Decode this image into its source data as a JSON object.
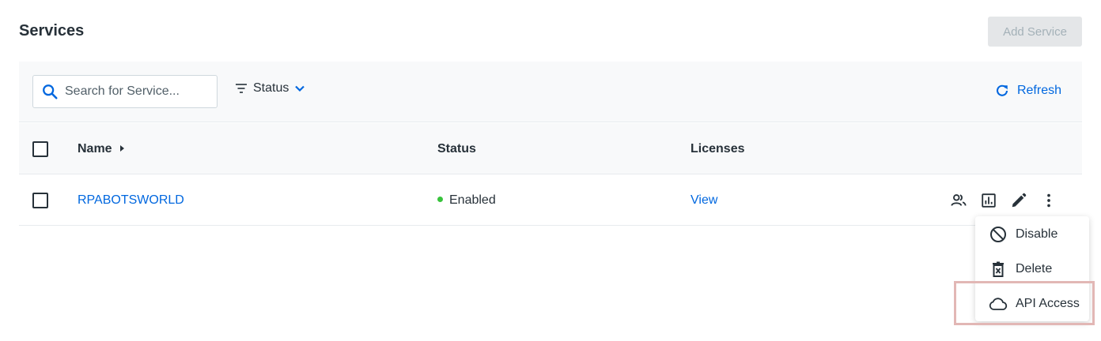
{
  "header": {
    "title": "Services",
    "add_service_label": "Add Service"
  },
  "toolbar": {
    "search_placeholder": "Search for Service...",
    "status_filter_label": "Status",
    "refresh_label": "Refresh"
  },
  "table": {
    "columns": {
      "name": "Name",
      "status": "Status",
      "licenses": "Licenses"
    },
    "rows": [
      {
        "name": "RPABOTSWORLD",
        "status": "Enabled",
        "licenses": "View"
      }
    ]
  },
  "context_menu": {
    "items": [
      {
        "label": "Disable",
        "icon": "disable-icon"
      },
      {
        "label": "Delete",
        "icon": "delete-icon"
      },
      {
        "label": "API Access",
        "icon": "cloud-icon"
      }
    ]
  },
  "colors": {
    "accent": "#0067df",
    "enabled": "#38c33c",
    "highlight": "#e2b7b5"
  }
}
